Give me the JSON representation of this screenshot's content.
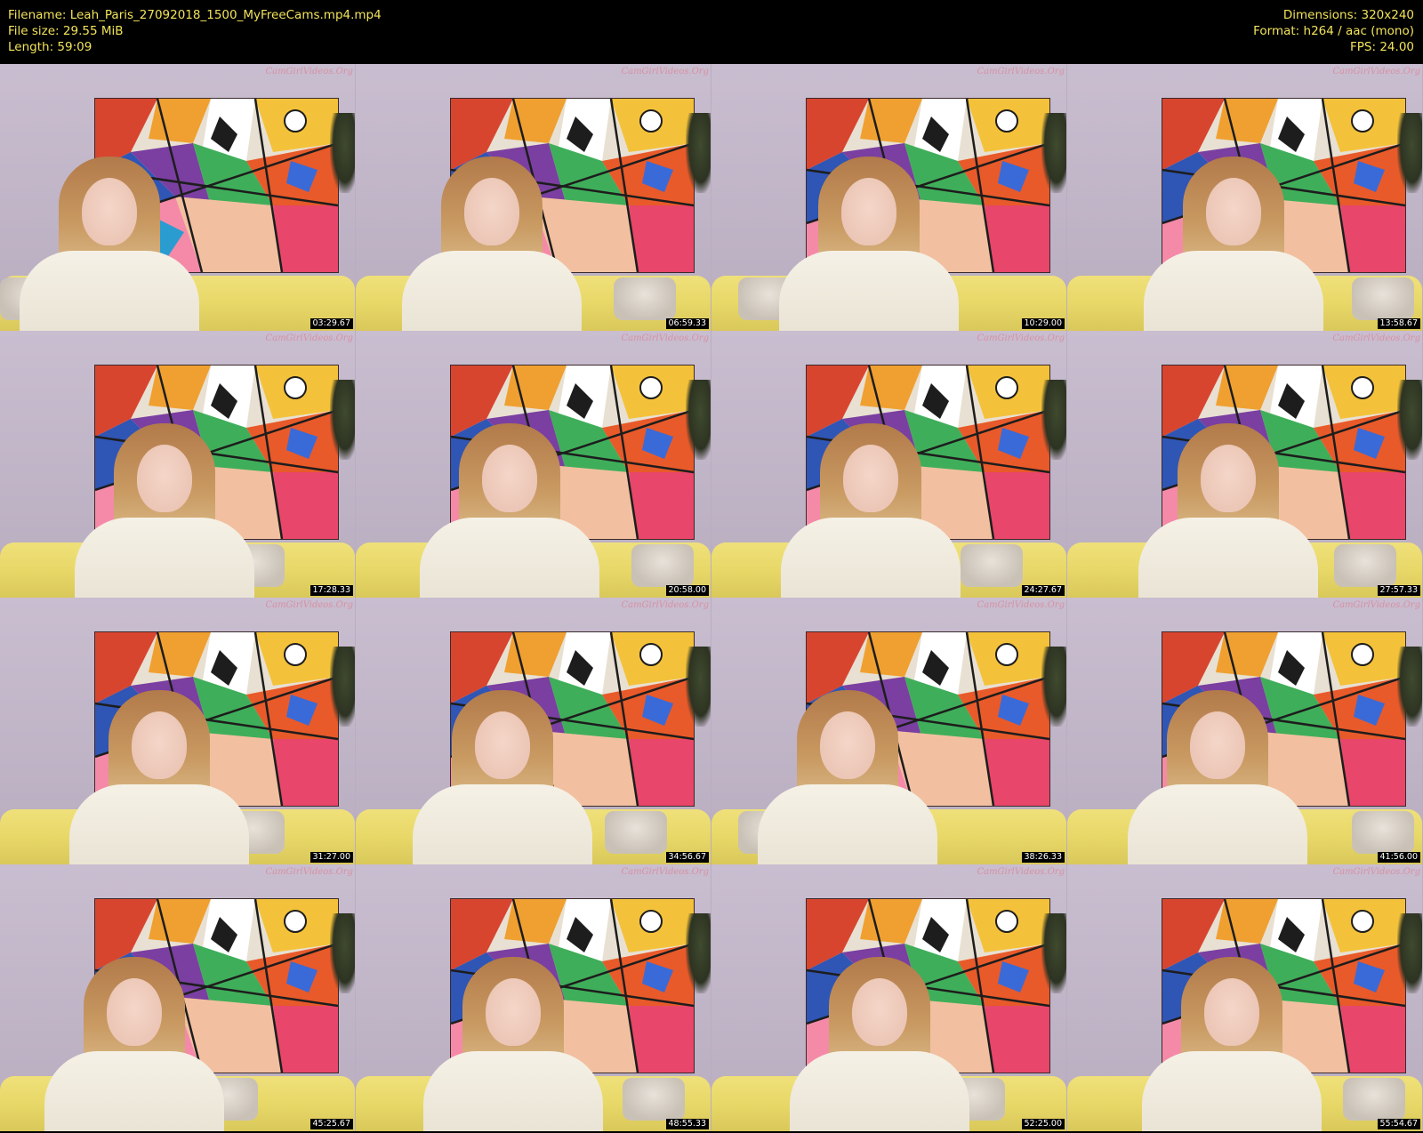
{
  "header": {
    "filename": "Filename: Leah_Paris_27092018_1500_MyFreeCams.mp4.mp4",
    "file_size": "File size: 29.55 MiB",
    "length": "Length: 59:09",
    "dimensions": "Dimensions: 320x240",
    "format": "Format: h264 / aac (mono)",
    "fps": "FPS: 24.00"
  },
  "colors": {
    "header_text": "#f2e35a",
    "header_bg": "#000000",
    "timestamp_bg": "#000000",
    "timestamp_text": "#ffffff"
  },
  "thumbnails": [
    {
      "time": "03:29.67",
      "watermark": "CamGirlVideos.Org"
    },
    {
      "time": "06:59.33",
      "watermark": "CamGirlVideos.Org"
    },
    {
      "time": "10:29.00",
      "watermark": "CamGirlVideos.Org"
    },
    {
      "time": "13:58.67",
      "watermark": "CamGirlVideos.Org"
    },
    {
      "time": "17:28.33",
      "watermark": "CamGirlVideos.Org"
    },
    {
      "time": "20:58.00",
      "watermark": "CamGirlVideos.Org"
    },
    {
      "time": "24:27.67",
      "watermark": "CamGirlVideos.Org"
    },
    {
      "time": "27:57.33",
      "watermark": "CamGirlVideos.Org"
    },
    {
      "time": "31:27.00",
      "watermark": "CamGirlVideos.Org"
    },
    {
      "time": "34:56.67",
      "watermark": "CamGirlVideos.Org"
    },
    {
      "time": "38:26.33",
      "watermark": "CamGirlVideos.Org"
    },
    {
      "time": "41:56.00",
      "watermark": "CamGirlVideos.Org"
    },
    {
      "time": "45:25.67",
      "watermark": "CamGirlVideos.Org"
    },
    {
      "time": "48:55.33",
      "watermark": "CamGirlVideos.Org"
    },
    {
      "time": "52:25.00",
      "watermark": "CamGirlVideos.Org"
    },
    {
      "time": "55:54.67",
      "watermark": "CamGirlVideos.Org"
    }
  ]
}
